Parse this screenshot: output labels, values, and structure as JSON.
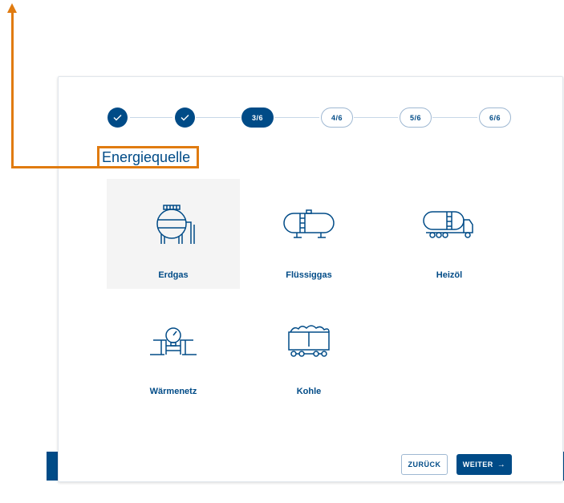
{
  "stepper": {
    "steps": [
      {
        "state": "done",
        "icon": "check-icon"
      },
      {
        "state": "done",
        "icon": "check-icon"
      },
      {
        "state": "active",
        "label": "3/6"
      },
      {
        "state": "todo",
        "label": "4/6"
      },
      {
        "state": "todo",
        "label": "5/6"
      },
      {
        "state": "todo",
        "label": "6/6"
      }
    ]
  },
  "section": {
    "title": "Energiequelle"
  },
  "options": [
    {
      "label": "Erdgas",
      "icon": "gas-tank-icon",
      "selected": true
    },
    {
      "label": "Flüssiggas",
      "icon": "lpg-tank-icon",
      "selected": false
    },
    {
      "label": "Heizöl",
      "icon": "oil-truck-icon",
      "selected": false
    },
    {
      "label": "Wärmenetz",
      "icon": "district-heating-pipe-icon",
      "selected": false
    },
    {
      "label": "Kohle",
      "icon": "coal-wagon-icon",
      "selected": false
    }
  ],
  "buttons": {
    "back": "ZURÜCK",
    "next": "WEITER",
    "next_icon": "→"
  },
  "colors": {
    "primary": "#004b87",
    "annotation": "#e07b10",
    "selected_bg": "#f4f4f4"
  }
}
